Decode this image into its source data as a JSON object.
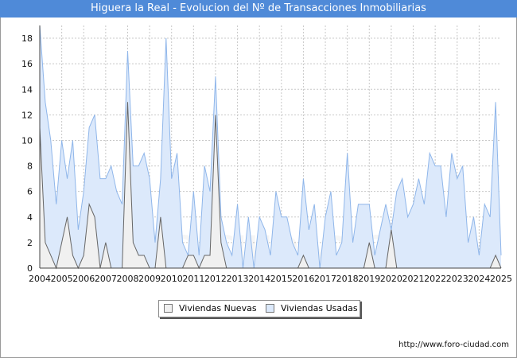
{
  "title": "Higuera la Real - Evolucion del Nº de Transacciones Inmobiliarias",
  "source": "http://www.foro-ciudad.com",
  "watermark": "FORO-CIUDAD.COM",
  "colors": {
    "title_bg": "#4f8ad8",
    "nuevas_fill": "#f0f0f0",
    "nuevas_line": "#666666",
    "usadas_fill": "#dce9fb",
    "usadas_line": "#8fb6ea"
  },
  "legend": {
    "nuevas_label": "Viviendas Nuevas",
    "usadas_label": "Viviendas Usadas"
  },
  "chart_data": {
    "type": "area",
    "title": "Higuera la Real - Evolucion del Nº de Transacciones Inmobiliarias",
    "xlabel": "",
    "ylabel": "",
    "ylim": [
      0,
      19
    ],
    "yticks": [
      0,
      2,
      4,
      6,
      8,
      10,
      12,
      14,
      16,
      18
    ],
    "grid": true,
    "legend_position": "bottom",
    "x_tick_labels": [
      "2004",
      "2005",
      "2006",
      "2007",
      "2008",
      "2009",
      "2010",
      "2011",
      "2012",
      "2013",
      "2014",
      "2015",
      "2016",
      "2017",
      "2018",
      "2019",
      "2020",
      "2021",
      "2022",
      "2023",
      "2024",
      "2025"
    ],
    "x_start": "2004 Q1",
    "x_end": "2025 Q1",
    "frequency": "quarterly",
    "series": [
      {
        "name": "Viviendas Usadas",
        "values": [
          19,
          13,
          10,
          5,
          10,
          7,
          10,
          3,
          6,
          11,
          12,
          7,
          7,
          8,
          6,
          5,
          17,
          8,
          8,
          9,
          7,
          2,
          7,
          18,
          7,
          9,
          2,
          1,
          6,
          1,
          8,
          6,
          15,
          4,
          2,
          1,
          5,
          0,
          4,
          0,
          4,
          3,
          1,
          6,
          4,
          4,
          2,
          1,
          7,
          3,
          5,
          0,
          4,
          6,
          1,
          2,
          9,
          2,
          5,
          5,
          5,
          1,
          3,
          5,
          3,
          6,
          7,
          4,
          5,
          7,
          5,
          9,
          8,
          8,
          4,
          9,
          7,
          8,
          2,
          4,
          1,
          5,
          4,
          13,
          1
        ]
      },
      {
        "name": "Viviendas Nuevas",
        "values": [
          11,
          2,
          1,
          0,
          2,
          4,
          1,
          0,
          1,
          5,
          4,
          0,
          2,
          0,
          0,
          0,
          13,
          2,
          1,
          1,
          0,
          0,
          4,
          0,
          0,
          0,
          0,
          1,
          1,
          0,
          1,
          1,
          12,
          2,
          0,
          0,
          0,
          0,
          0,
          0,
          0,
          0,
          0,
          0,
          0,
          0,
          0,
          0,
          1,
          0,
          0,
          0,
          0,
          0,
          0,
          0,
          0,
          0,
          0,
          0,
          2,
          0,
          0,
          0,
          3,
          0,
          0,
          0,
          0,
          0,
          0,
          0,
          0,
          0,
          0,
          0,
          0,
          0,
          0,
          0,
          0,
          0,
          0,
          1,
          0
        ]
      }
    ]
  }
}
